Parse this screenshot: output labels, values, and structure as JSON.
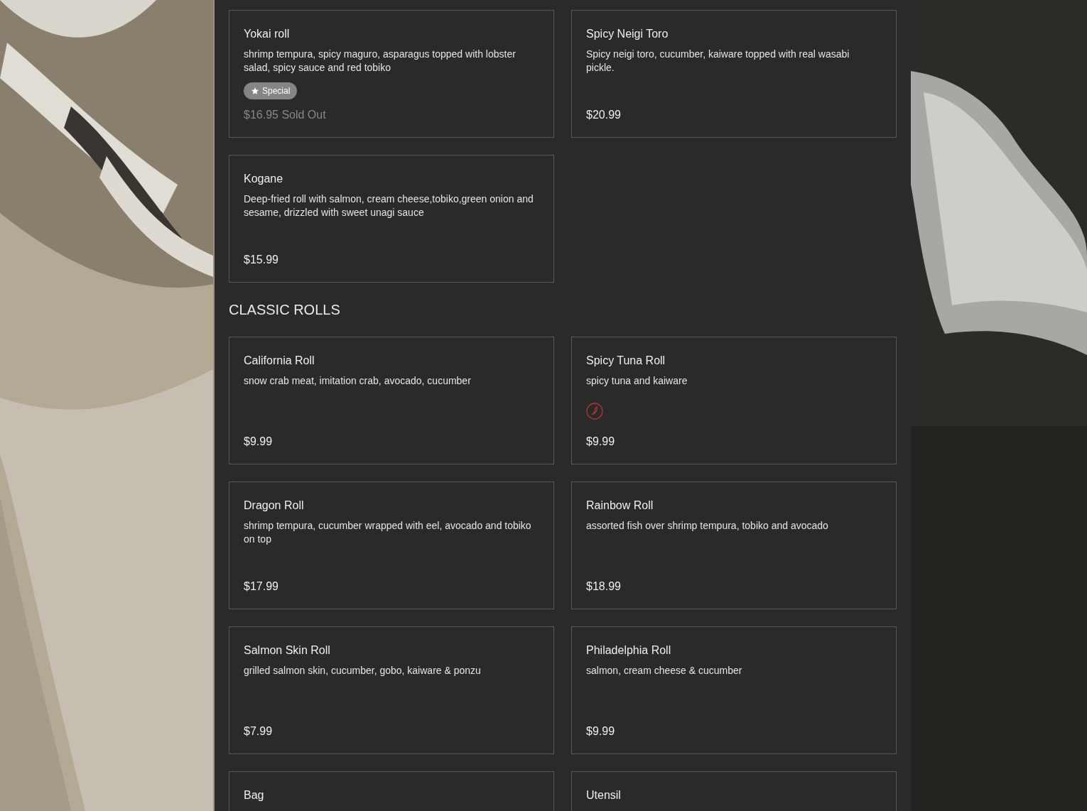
{
  "sections": [
    {
      "items": [
        {
          "name": "Yokai roll",
          "description": "shrimp tempura, spicy maguro, asparagus topped with lobster salad, spicy sauce and red tobiko",
          "badges": [
            {
              "kind": "special",
              "label": "Special"
            }
          ],
          "price": "$16.95",
          "sold_out": true,
          "sold_out_label": "Sold Out"
        },
        {
          "name": "Spicy Neigi Toro",
          "description": "Spicy neigi toro, cucumber, kaiware topped with real wasabi pickle.",
          "price": "$20.99",
          "sold_out": false
        },
        {
          "name": "Kogane",
          "description": "Deep-fried roll with salmon, cream cheese,tobiko,green onion and sesame, drizzled with sweet unagi sauce",
          "price": "$15.99",
          "sold_out": false
        }
      ]
    },
    {
      "heading": "CLASSIC ROLLS",
      "items": [
        {
          "name": "California Roll",
          "description": "snow crab meat, imitation crab, avocado, cucumber",
          "price": "$9.99",
          "sold_out": false
        },
        {
          "name": "Spicy Tuna Roll",
          "description": "spicy tuna and kaiware",
          "badges": [
            {
              "kind": "spicy"
            }
          ],
          "price": "$9.99",
          "sold_out": false
        },
        {
          "name": "Dragon Roll",
          "description": "shrimp tempura, cucumber wrapped with eel, avocado and tobiko on top",
          "price": "$17.99",
          "sold_out": false
        },
        {
          "name": "Rainbow Roll",
          "description": "assorted fish over shrimp tempura, tobiko and avocado",
          "price": "$18.99",
          "sold_out": false
        },
        {
          "name": "Salmon Skin Roll",
          "description": "grilled salmon skin, cucumber, gobo, kaiware & ponzu",
          "price": "$7.99",
          "sold_out": false
        },
        {
          "name": "Philadelphia Roll",
          "description": "salmon, cream cheese & cucumber",
          "price": "$9.99",
          "sold_out": false
        },
        {
          "name": "Bag"
        },
        {
          "name": "Utensil"
        }
      ]
    }
  ]
}
